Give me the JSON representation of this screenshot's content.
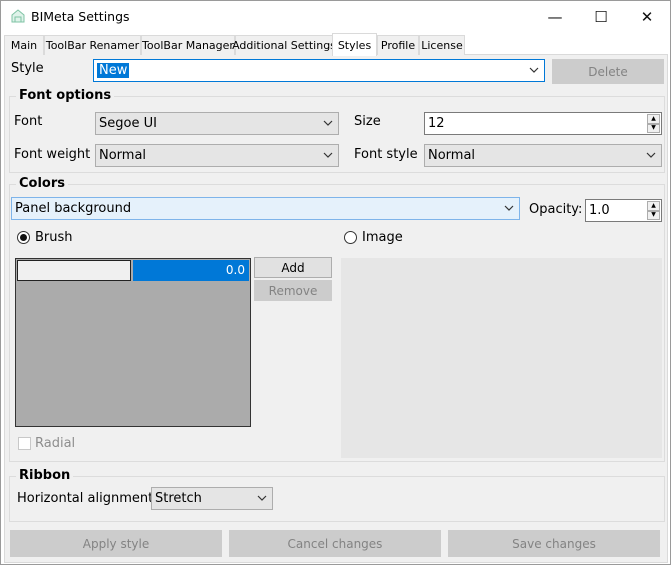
{
  "window": {
    "title": "BIMeta Settings",
    "minimize_glyph": "—",
    "maximize_glyph": "☐",
    "close_glyph": "✕"
  },
  "tabs": [
    {
      "label": "Main"
    },
    {
      "label": "ToolBar Renamer"
    },
    {
      "label": "ToolBar Manager"
    },
    {
      "label": "Additional Settings"
    },
    {
      "label": "Styles"
    },
    {
      "label": "Profile"
    },
    {
      "label": "License"
    }
  ],
  "active_tab": "Styles",
  "style_row": {
    "label": "Style",
    "value": "New",
    "delete_label": "Delete"
  },
  "font_options": {
    "title": "Font options",
    "font_label": "Font",
    "font_value": "Segoe UI",
    "size_label": "Size",
    "size_value": "12",
    "weight_label": "Font weight",
    "weight_value": "Normal",
    "style_label": "Font style",
    "style_value": "Normal"
  },
  "colors": {
    "title": "Colors",
    "target_value": "Panel background",
    "opacity_label": "Opacity:",
    "opacity_value": "1.0",
    "brush_label": "Brush",
    "image_label": "Image",
    "brush_selected": true,
    "stop_value": "0.0",
    "add_label": "Add",
    "remove_label": "Remove",
    "radial_label": "Radial",
    "stop_color": "#0078d7",
    "preview_color": "#ababab"
  },
  "ribbon": {
    "title": "Ribbon",
    "halign_label": "Horizontal alignment",
    "halign_value": "Stretch"
  },
  "footer": {
    "apply_label": "Apply style",
    "cancel_label": "Cancel changes",
    "save_label": "Save changes"
  }
}
